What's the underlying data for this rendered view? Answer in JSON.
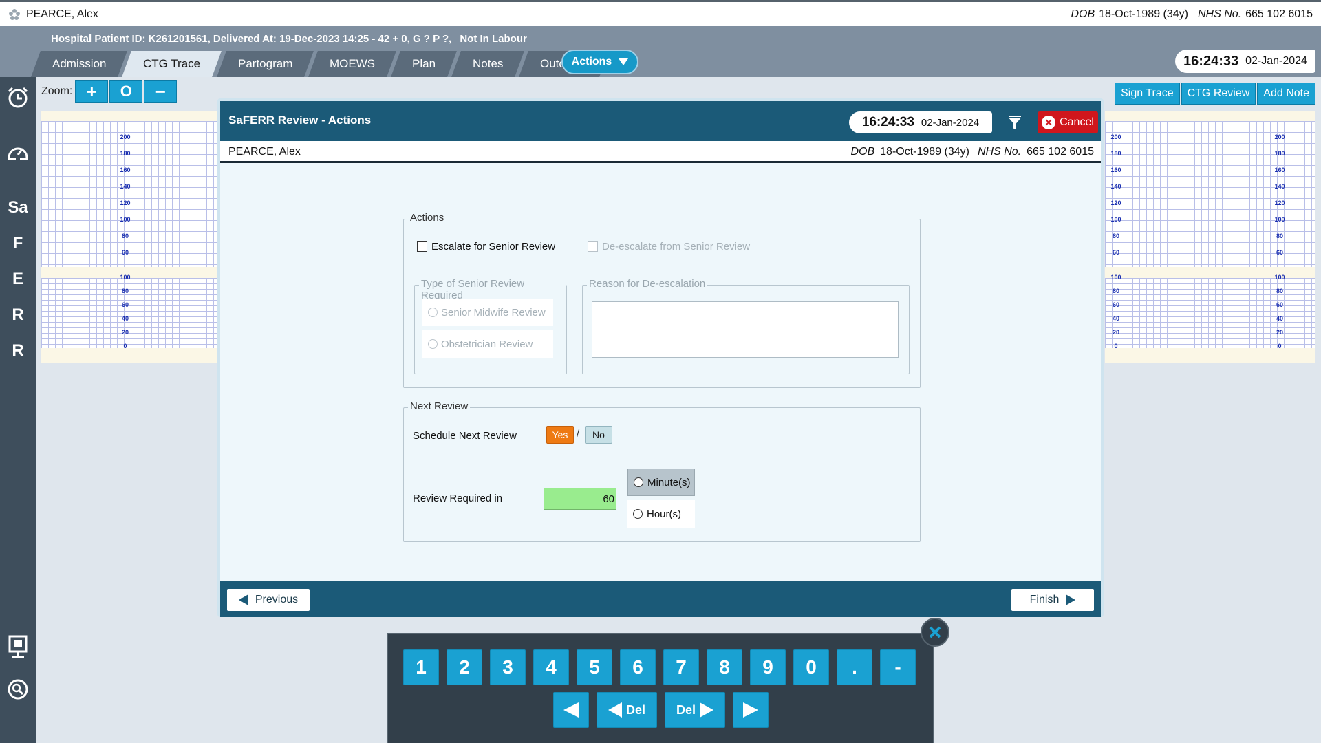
{
  "patient": {
    "name": "PEARCE, Alex",
    "dob_label": "DOB",
    "dob": "18-Oct-1989 (34y)",
    "nhs_label": "NHS No.",
    "nhs": "665 102 6015"
  },
  "header": {
    "hospital_info": "Hospital Patient ID: K261201561, Delivered At: 19-Dec-2023 14:25 - 42 + 0, G ? P ?,",
    "labour_status": "Not In Labour",
    "tabs": [
      {
        "label": "Admission"
      },
      {
        "label": "CTG Trace"
      },
      {
        "label": "Partogram"
      },
      {
        "label": "MOEWS"
      },
      {
        "label": "Plan"
      },
      {
        "label": "Notes"
      },
      {
        "label": "Outcome"
      }
    ],
    "active_tab": "CTG Trace",
    "actions_label": "Actions",
    "time": "16:24:33",
    "date": "02-Jan-2024"
  },
  "sidebar": {
    "items": [
      {
        "icon": "alarm-clock-icon"
      },
      {
        "icon": "speedometer-icon"
      },
      {
        "label": "Sa"
      },
      {
        "label": "F"
      },
      {
        "label": "E"
      },
      {
        "label": "R"
      },
      {
        "label": "R"
      },
      {
        "icon": "monitor-icon"
      },
      {
        "icon": "search-icon"
      }
    ]
  },
  "toolbar": {
    "zoom_label": "Zoom:",
    "zoom_in": "+",
    "zoom_reset": "O",
    "zoom_out": "−",
    "sign_trace": "Sign Trace",
    "ctg_review": "CTG Review",
    "add_note": "Add Note"
  },
  "trace": {
    "fhr_ticks": [
      "200",
      "180",
      "160",
      "140",
      "120",
      "100",
      "80",
      "60"
    ],
    "toco_ticks": [
      "100",
      "80",
      "60",
      "40",
      "20",
      "0"
    ]
  },
  "modal": {
    "title": "SaFERR Review - Actions",
    "time": "16:24:33",
    "date": "02-Jan-2024",
    "cancel_label": "Cancel",
    "actions_legend": "Actions",
    "escalate_label": "Escalate for Senior Review",
    "deescalate_label": "De-escalate from Senior Review",
    "type_legend": "Type of Senior Review Required",
    "senior_midwife": "Senior Midwife Review",
    "obstetrician": "Obstetrician Review",
    "reason_legend": "Reason for De-escalation",
    "next_legend": "Next Review",
    "schedule_label": "Schedule Next Review",
    "yes_label": "Yes",
    "slash": "/",
    "no_label": "No",
    "review_required_label": "Review Required in",
    "review_value": "60",
    "minutes_label": "Minute(s)",
    "hours_label": "Hour(s)",
    "previous_label": "Previous",
    "finish_label": "Finish"
  },
  "keypad": {
    "digits": [
      "1",
      "2",
      "3",
      "4",
      "5",
      "6",
      "7",
      "8",
      "9",
      "0",
      ".",
      "-"
    ],
    "del_left": "Del",
    "del_right": "Del"
  },
  "colors": {
    "accent": "#1aa1d2",
    "modal_header": "#1b5a78",
    "yes_active": "#ee7a13",
    "input_ok": "#99ec8e",
    "cancel": "#d0161c"
  }
}
